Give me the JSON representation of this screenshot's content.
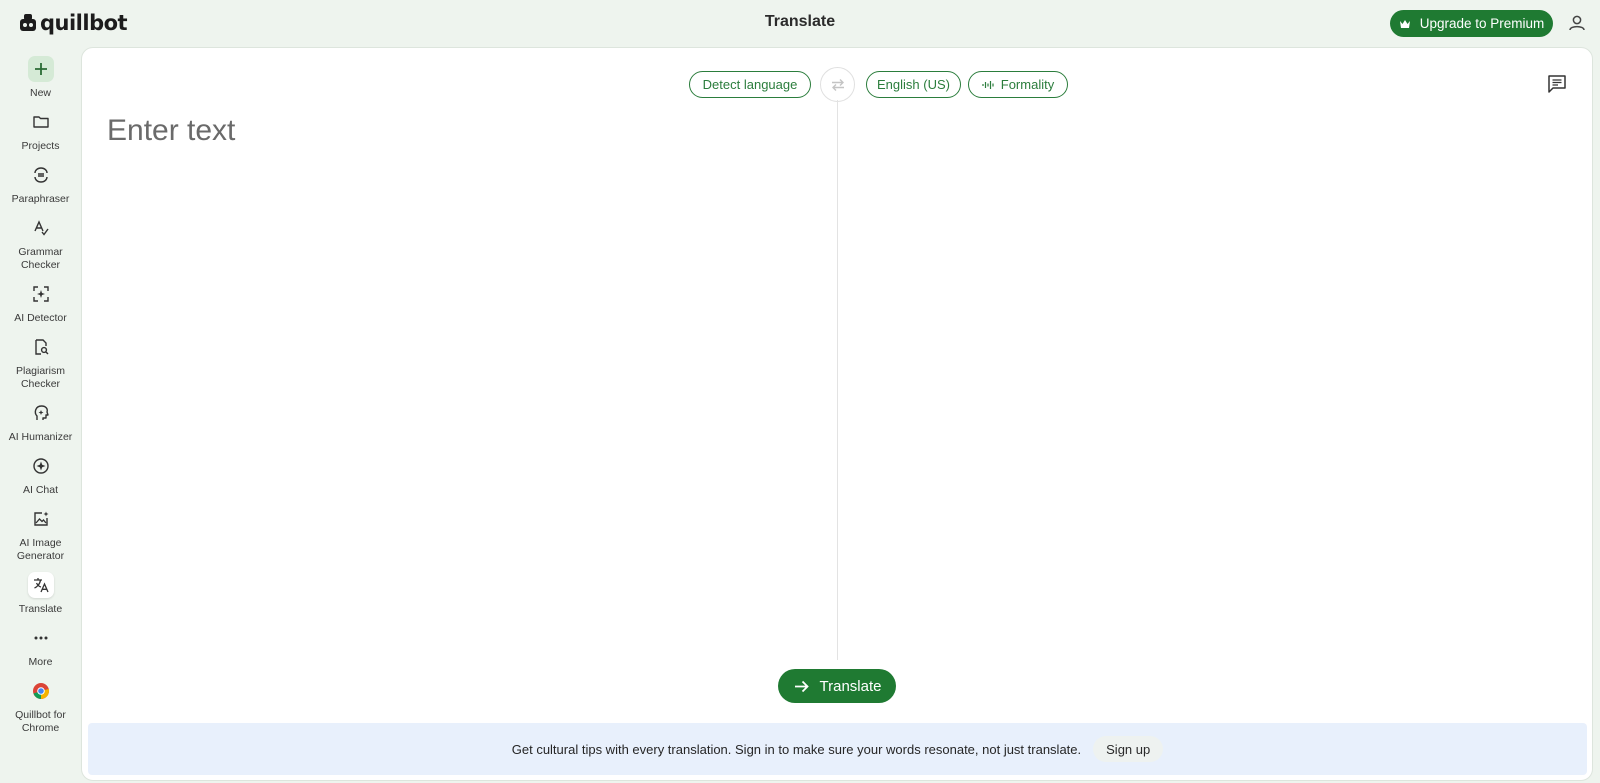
{
  "header": {
    "logo_text": "quillbot",
    "title": "Translate",
    "upgrade_label": "Upgrade to Premium"
  },
  "sidebar": {
    "items": [
      {
        "label": "New",
        "icon": "plus-icon"
      },
      {
        "label": "Projects",
        "icon": "folder-icon"
      },
      {
        "label": "Paraphraser",
        "icon": "paraphraser-icon"
      },
      {
        "label": "Grammar Checker",
        "icon": "grammar-icon"
      },
      {
        "label": "AI Detector",
        "icon": "ai-detector-icon"
      },
      {
        "label": "Plagiarism Checker",
        "icon": "plagiarism-icon"
      },
      {
        "label": "AI Humanizer",
        "icon": "humanizer-icon"
      },
      {
        "label": "AI Chat",
        "icon": "chat-icon"
      },
      {
        "label": "AI Image Generator",
        "icon": "image-generator-icon"
      },
      {
        "label": "Translate",
        "icon": "translate-icon"
      },
      {
        "label": "More",
        "icon": "more-icon"
      },
      {
        "label": "Quillbot for Chrome",
        "icon": "chrome-icon"
      }
    ]
  },
  "toolbar": {
    "source_language": "Detect language",
    "target_language": "English (US)",
    "formality_label": "Formality"
  },
  "editor": {
    "placeholder": "Enter text",
    "value": ""
  },
  "actions": {
    "translate_label": "Translate"
  },
  "banner": {
    "text": "Get cultural tips with every translation. Sign in to make sure your words resonate, not just translate.",
    "signup_label": "Sign up"
  },
  "colors": {
    "brand_green": "#1f7a32",
    "page_bg": "#eef4ee",
    "banner_bg": "#e8f0fc"
  }
}
